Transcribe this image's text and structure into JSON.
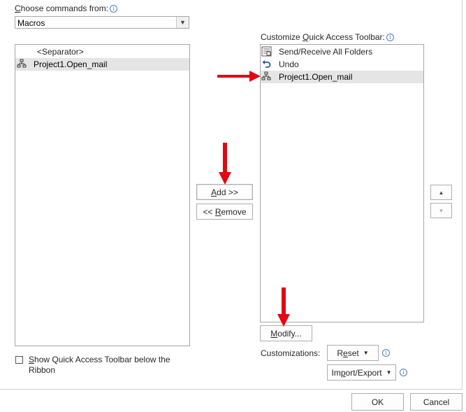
{
  "choose": {
    "label_first": "C",
    "label_rest": "hoose commands from:",
    "info": "i",
    "value": "Macros"
  },
  "left_list": {
    "items": [
      {
        "label": "<Separator>",
        "icon": "none"
      },
      {
        "label": "Project1.Open_mail",
        "icon": "macro-icon"
      }
    ]
  },
  "customize": {
    "label_a": "Customize ",
    "label_u": "Q",
    "label_b": "uick Access Toolbar:",
    "info": "i"
  },
  "right_list": {
    "items": [
      {
        "label": "Send/Receive All Folders",
        "icon": "send-receive-icon"
      },
      {
        "label": "Undo",
        "icon": "undo-icon"
      },
      {
        "label": "Project1.Open_mail",
        "icon": "macro-icon"
      }
    ]
  },
  "buttons": {
    "add_u": "A",
    "add_rest": "dd >>",
    "remove_pre": "<< ",
    "remove_u": "R",
    "remove_rest": "emove",
    "modify_u": "M",
    "modify_rest": "odify...",
    "reset_pre": "R",
    "reset_u": "e",
    "reset_rest": "set",
    "import_pre": "Im",
    "import_u": "p",
    "import_rest": "ort/Export",
    "ok": "OK",
    "cancel": "Cancel"
  },
  "customizations_label": "Customizations:",
  "show_below": {
    "label_u": "S",
    "label_line1_rest": "how Quick Access Toolbar below the",
    "label_line2": "Ribbon",
    "checked": false
  },
  "colors": {
    "arrow": "#e30613",
    "selection": "#e5e5e5",
    "border": "#a6a6a6",
    "accent": "#4a7fc1"
  }
}
